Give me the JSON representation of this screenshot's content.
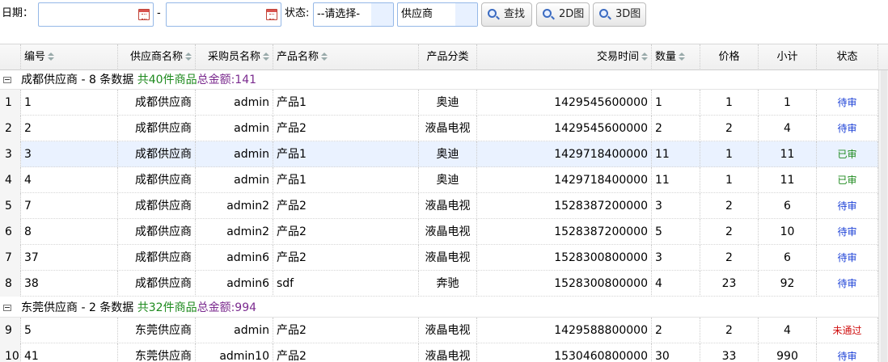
{
  "toolbar": {
    "date_label": "日期：",
    "date_separator": "-",
    "date_start_value": "",
    "date_end_value": "",
    "status_label": "状态:",
    "status_select": "--请选择-",
    "supplier_select": "供应商",
    "search_label": "查找",
    "chart2d_label": "2D图",
    "chart3d_label": "3D图"
  },
  "columns": [
    "编号",
    "供应商名称",
    "采购员名称",
    "产品名称",
    "产品分类",
    "交易时间",
    "数量",
    "价格",
    "小计",
    "状态"
  ],
  "groups": [
    {
      "name": "成都供应商 - 8 条数据",
      "count": "共40件商品",
      "total": "总金额:141",
      "rows": [
        {
          "n": "1",
          "id": "1",
          "supplier": "成都供应商",
          "buyer": "admin",
          "product": "产品1",
          "category": "奥迪",
          "time": "1429545600000",
          "qty": "1",
          "price": "1",
          "subtotal": "1",
          "status": "待审",
          "status_type": "pending"
        },
        {
          "n": "2",
          "id": "2",
          "supplier": "成都供应商",
          "buyer": "admin",
          "product": "产品2",
          "category": "液晶电视",
          "time": "1429545600000",
          "qty": "2",
          "price": "2",
          "subtotal": "4",
          "status": "待审",
          "status_type": "pending"
        },
        {
          "n": "3",
          "id": "3",
          "supplier": "成都供应商",
          "buyer": "admin",
          "product": "产品1",
          "category": "奥迪",
          "time": "1429718400000",
          "qty": "11",
          "price": "1",
          "subtotal": "11",
          "status": "已审",
          "status_type": "approved",
          "selected": true
        },
        {
          "n": "4",
          "id": "4",
          "supplier": "成都供应商",
          "buyer": "admin",
          "product": "产品1",
          "category": "奥迪",
          "time": "1429718400000",
          "qty": "11",
          "price": "1",
          "subtotal": "11",
          "status": "已审",
          "status_type": "approved"
        },
        {
          "n": "5",
          "id": "7",
          "supplier": "成都供应商",
          "buyer": "admin2",
          "product": "产品2",
          "category": "液晶电视",
          "time": "1528387200000",
          "qty": "3",
          "price": "2",
          "subtotal": "6",
          "status": "待审",
          "status_type": "pending"
        },
        {
          "n": "6",
          "id": "8",
          "supplier": "成都供应商",
          "buyer": "admin2",
          "product": "产品2",
          "category": "液晶电视",
          "time": "1528387200000",
          "qty": "5",
          "price": "2",
          "subtotal": "10",
          "status": "待审",
          "status_type": "pending"
        },
        {
          "n": "7",
          "id": "37",
          "supplier": "成都供应商",
          "buyer": "admin6",
          "product": "产品2",
          "category": "液晶电视",
          "time": "1528300800000",
          "qty": "3",
          "price": "2",
          "subtotal": "6",
          "status": "待审",
          "status_type": "pending"
        },
        {
          "n": "8",
          "id": "38",
          "supplier": "成都供应商",
          "buyer": "admin6",
          "product": "sdf",
          "category": "奔驰",
          "time": "1528300800000",
          "qty": "4",
          "price": "23",
          "subtotal": "92",
          "status": "待审",
          "status_type": "pending"
        }
      ]
    },
    {
      "name": "东莞供应商 - 2 条数据",
      "count": "共32件商品",
      "total": "总金额:994",
      "rows": [
        {
          "n": "9",
          "id": "5",
          "supplier": "东莞供应商",
          "buyer": "admin",
          "product": "产品2",
          "category": "液晶电视",
          "time": "1429588800000",
          "qty": "2",
          "price": "2",
          "subtotal": "4",
          "status": "未通过",
          "status_type": "rejected"
        },
        {
          "n": "10",
          "id": "41",
          "supplier": "东莞供应商",
          "buyer": "admin10",
          "product": "产品2",
          "category": "液晶电视",
          "time": "1530460800000",
          "qty": "30",
          "price": "33",
          "subtotal": "990",
          "status": "待审",
          "status_type": "pending"
        }
      ]
    }
  ]
}
